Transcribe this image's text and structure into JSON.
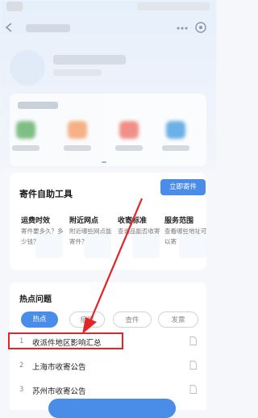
{
  "service_tools": {
    "title": "寄件自助工具",
    "ship_button": "立即寄件",
    "items": [
      {
        "name": "运费时效",
        "desc": "寄件要多久？多少钱？"
      },
      {
        "name": "附近网点",
        "desc": "附近哪些网点能寄件？"
      },
      {
        "name": "收寄标准",
        "desc": "查询品能否收寄"
      },
      {
        "name": "服务范围",
        "desc": "查看哪些地址可以寄"
      }
    ]
  },
  "hot_issues": {
    "title": "热点问题",
    "tabs": [
      "热点",
      "疫情",
      "查件",
      "发票"
    ],
    "questions": [
      {
        "num": "1",
        "text": "收派件地区影响汇总"
      },
      {
        "num": "2",
        "text": "上海市收寄公告"
      },
      {
        "num": "3",
        "text": "苏州市收寄公告"
      }
    ]
  },
  "colors": {
    "accent": "#4a8de8",
    "highlight": "#e02626"
  }
}
